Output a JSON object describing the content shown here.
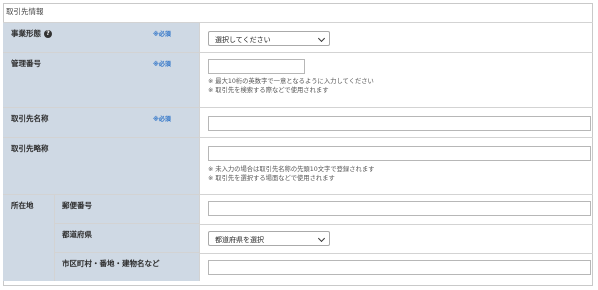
{
  "section": {
    "title": "取引先情報"
  },
  "required_mark": "※必須",
  "business_type": {
    "label": "事業形態",
    "help_icon": "question-circle-icon",
    "select_value": "選択してください"
  },
  "management_no": {
    "label": "管理番号",
    "value": "",
    "notes": [
      "※ 最大10桁の英数字で一意となるように入力してください",
      "※ 取引先を検索する際などで使用されます"
    ]
  },
  "client_name": {
    "label": "取引先名称",
    "value": ""
  },
  "client_short": {
    "label": "取引先略称",
    "value": "",
    "notes": [
      "※ 未入力の場合は取引先名称の先頭10文字で登録されます",
      "※ 取引先を選択する場面などで使用されます"
    ]
  },
  "address": {
    "label": "所在地",
    "postal": {
      "label": "郵便番号",
      "value": ""
    },
    "prefecture": {
      "label": "都道府県",
      "select_value": "都道府県を選択"
    },
    "city": {
      "label": "市区町村・番地・建物名など",
      "value": ""
    }
  },
  "colors": {
    "label_bg": "#cfd9e4",
    "required": "#2f74c8",
    "border": "#d3d3d3"
  }
}
